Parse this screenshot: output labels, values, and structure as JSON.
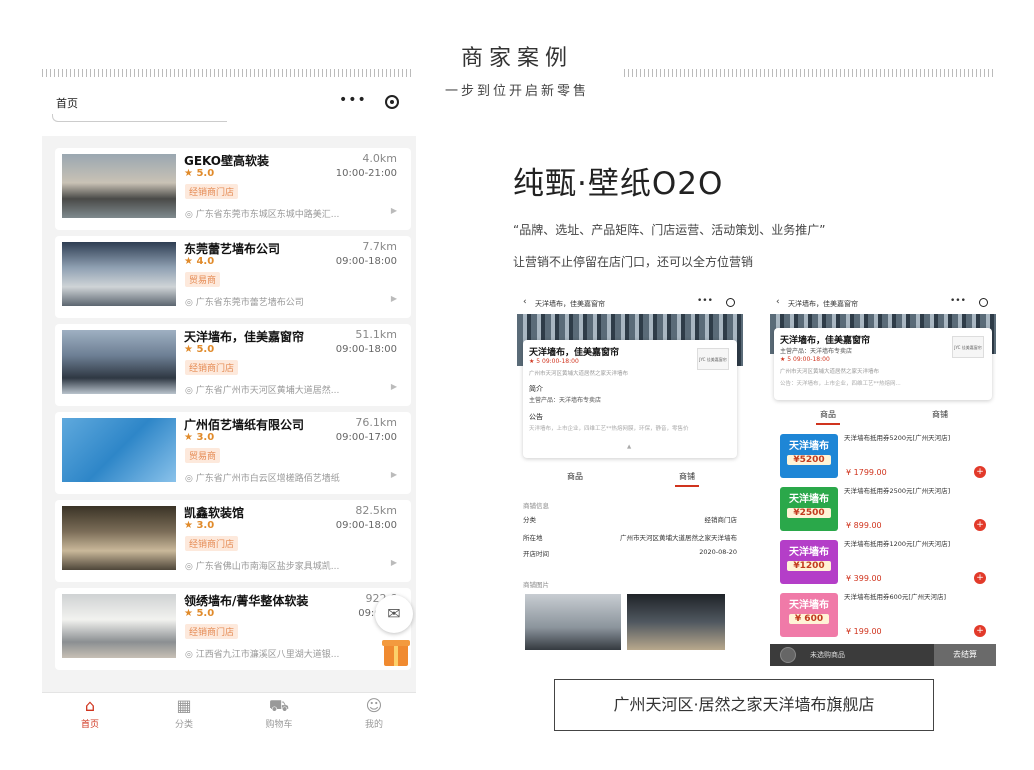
{
  "header": {
    "title": "商家案例",
    "subtitle": "一步到位开启新零售"
  },
  "left_phone": {
    "nav_title": "首页",
    "more_icon": "more-dots-icon",
    "target_icon": "target-icon",
    "stores": [
      {
        "name": "GEKO壁高软装",
        "distance": "4.0km",
        "rating": "5.0",
        "hours": "10:00-21:00",
        "tag": "经销商门店",
        "address": "广东省东莞市东城区东城中路美汇..."
      },
      {
        "name": "东莞蕾艺墙布公司",
        "distance": "7.7km",
        "rating": "4.0",
        "hours": "09:00-18:00",
        "tag": "贸易商",
        "address": "广东省东莞市蕾艺墙布公司"
      },
      {
        "name": "天洋墙布，佳美嘉窗帘",
        "distance": "51.1km",
        "rating": "5.0",
        "hours": "09:00-18:00",
        "tag": "经销商门店",
        "address": "广东省广州市天河区黄埔大道居然..."
      },
      {
        "name": "广州佰艺墙纸有限公司",
        "distance": "76.1km",
        "rating": "3.0",
        "hours": "09:00-17:00",
        "tag": "贸易商",
        "address": "广东省广州市白云区增槎路佰艺墙纸"
      },
      {
        "name": "凯鑫软装馆",
        "distance": "82.5km",
        "rating": "3.0",
        "hours": "09:00-18:00",
        "tag": "经销商门店",
        "address": "广东省佛山市南海区盐步家具城凯..."
      },
      {
        "name": "领绣墙布/菁华整体软装",
        "distance": "922.6",
        "rating": "5.0",
        "hours": "09:00-1",
        "tag": "经销商门店",
        "address": "江西省九江市濂溪区八里湖大道银..."
      }
    ],
    "tabs": [
      {
        "label": "首页",
        "icon": "home-icon",
        "active": true
      },
      {
        "label": "分类",
        "icon": "grid-icon",
        "active": false
      },
      {
        "label": "购物车",
        "icon": "cart-icon",
        "active": false
      },
      {
        "label": "我的",
        "icon": "user-icon",
        "active": false
      }
    ]
  },
  "right": {
    "title": "纯甄·壁纸O2O",
    "quote": "“品牌、选址、产品矩阵、门店运营、活动策划、业务推广”",
    "line": "让营销不止停留在店门口，还可以全方位营销",
    "caption": "广州天河区·居然之家天洋墙布旗舰店"
  },
  "mini_a": {
    "nav_title": "天洋墙布，佳美嘉窗帘",
    "store_name": "天洋墙布，佳美嘉窗帘",
    "rating_line": "★ 5  09:00-18:00",
    "address": "广州市天河区黄埔大道居然之家天洋墙布",
    "logo_text": "JYC 佳美嘉窗帘",
    "intro_label": "简介",
    "intro_value": "主营产品：天洋墙布专卖店",
    "notice_label": "公告",
    "notice_value": "天洋墙布，上市企业，四维工艺**热熔网膜，环保，静音，零售价",
    "tab_goods": "商品",
    "tab_shop": "商铺",
    "shop_info_title": "商铺信息",
    "rows": [
      {
        "k": "分类",
        "v": "经销商门店"
      },
      {
        "k": "所在地",
        "v": "广州市天河区黄埔大道居然之家天洋墙布"
      },
      {
        "k": "开店时间",
        "v": "2020-08-20"
      }
    ],
    "shop_pics_title": "商铺图片"
  },
  "mini_b": {
    "nav_title": "天洋墙布，佳美嘉窗帘",
    "store_name": "天洋墙布，佳美嘉窗帘",
    "main_products": "主营产品：天洋墙布专卖店",
    "rating_line": "★ 5  09:00-18:00",
    "address": "广州市天河区黄埔大道居然之家天洋墙布",
    "notice": "公告：天洋墙布，上市企业，四维工艺**热熔网...",
    "logo_text": "JYC 佳美嘉窗帘",
    "tab_goods": "商品",
    "tab_shop": "商铺",
    "coupon_brand": "天洋墙布",
    "products": [
      {
        "name": "天洋墙布抵用券5200元[广州天河店]",
        "price": "¥ 1799.00",
        "coupon_value": "¥5200",
        "color": "#1e86d6"
      },
      {
        "name": "天洋墙布抵用券2500元[广州天河店]",
        "price": "¥ 899.00",
        "coupon_value": "¥2500",
        "color": "#2aa84a"
      },
      {
        "name": "天洋墙布抵用券1200元[广州天河店]",
        "price": "¥ 399.00",
        "coupon_value": "¥1200",
        "color": "#b43ec8"
      },
      {
        "name": "天洋墙布抵用券600元[广州天河店]",
        "price": "¥ 199.00",
        "coupon_value": "¥ 600",
        "color": "#f07aa8"
      }
    ],
    "cart_text": "未选购商品",
    "checkout_label": "去结算"
  }
}
